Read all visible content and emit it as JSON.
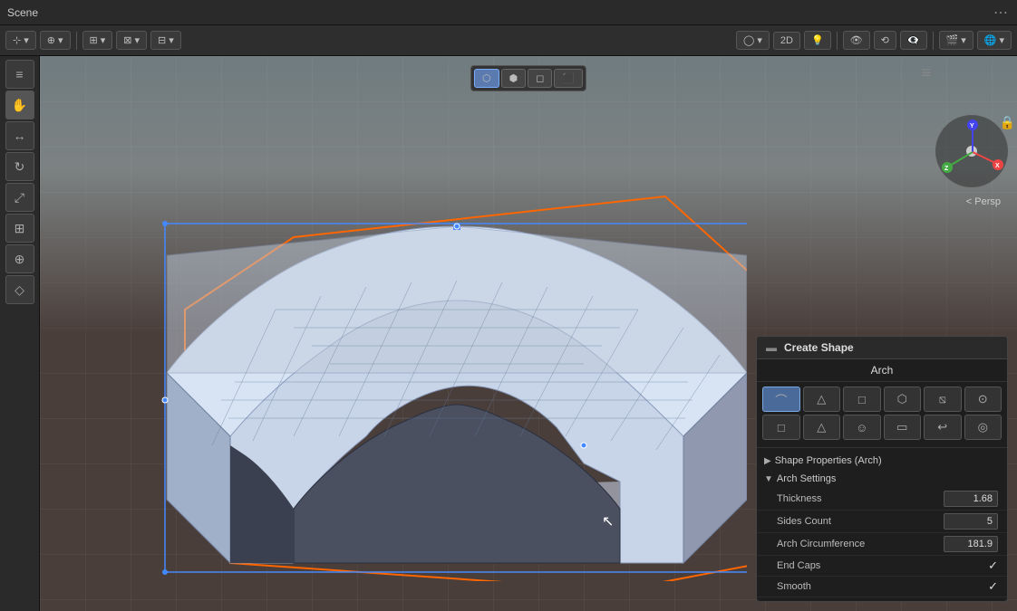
{
  "window": {
    "title": "Scene",
    "menu_dots": "⋯"
  },
  "toolbar": {
    "items": [
      {
        "label": "🔀",
        "id": "transform"
      },
      {
        "label": "↗",
        "id": "move"
      },
      {
        "label": "⊞",
        "id": "grid1"
      },
      {
        "label": "⊟",
        "id": "grid2"
      },
      {
        "label": "⊠",
        "id": "grid3"
      }
    ],
    "right_items": [
      {
        "label": "◯",
        "id": "shape"
      },
      {
        "label": "2D",
        "id": "2d"
      },
      {
        "label": "💡",
        "id": "light"
      },
      {
        "label": "👁",
        "id": "view"
      },
      {
        "label": "⟲",
        "id": "rotate"
      },
      {
        "label": "👁‍🗨",
        "id": "render"
      },
      {
        "label": "🎬",
        "id": "camera"
      },
      {
        "label": "🌐",
        "id": "world"
      }
    ]
  },
  "viewport": {
    "header_buttons": [
      {
        "label": "⬡",
        "id": "solid",
        "active": true
      },
      {
        "label": "⬢",
        "id": "wireframe",
        "active": false
      },
      {
        "label": "◻",
        "id": "material",
        "active": false
      },
      {
        "label": "⬛",
        "id": "rendered",
        "active": false
      }
    ],
    "perspective_label": "< Persp",
    "menu_icon": "≡"
  },
  "sidebar": {
    "buttons": [
      {
        "icon": "≡",
        "label": "menu",
        "active": false
      },
      {
        "icon": "✋",
        "label": "grab",
        "active": true
      },
      {
        "icon": "↔",
        "label": "move",
        "active": false
      },
      {
        "icon": "↻",
        "label": "rotate",
        "active": false
      },
      {
        "icon": "⤢",
        "label": "scale",
        "active": false
      },
      {
        "icon": "⊞",
        "label": "transform",
        "active": false
      },
      {
        "icon": "⊕",
        "label": "annotate",
        "active": false
      },
      {
        "icon": "◇",
        "label": "measure",
        "active": false
      }
    ]
  },
  "gizmo": {
    "x_label": "X",
    "y_label": "Y",
    "z_label": "Z"
  },
  "panel": {
    "header_dots": "▬",
    "title": "Create Shape",
    "subtitle": "Arch",
    "shape_types_row1": [
      {
        "icon": "⌒",
        "id": "arch",
        "active": true
      },
      {
        "icon": "△",
        "id": "triangle"
      },
      {
        "icon": "□",
        "id": "box"
      },
      {
        "icon": "⬡",
        "id": "cylinder"
      },
      {
        "icon": "⧅",
        "id": "capsule"
      },
      {
        "icon": "⊙",
        "id": "torus"
      }
    ],
    "shape_types_row2": [
      {
        "icon": "□",
        "id": "plane"
      },
      {
        "icon": "△",
        "id": "cone"
      },
      {
        "icon": "☺",
        "id": "sphere"
      },
      {
        "icon": "▭",
        "id": "quad"
      },
      {
        "icon": "↩",
        "id": "curve"
      },
      {
        "icon": "◎",
        "id": "circle"
      }
    ],
    "sections": {
      "shape_properties": {
        "label": "Shape Properties (Arch)",
        "collapsed": true
      },
      "arch_settings": {
        "label": "Arch Settings",
        "collapsed": false
      }
    },
    "properties": {
      "thickness": {
        "label": "Thickness",
        "value": "1.68"
      },
      "sides_count": {
        "label": "Sides Count",
        "value": "5"
      },
      "arch_circumference": {
        "label": "Arch Circumference",
        "value": "181.9"
      },
      "end_caps": {
        "label": "End Caps",
        "checked": true,
        "check_icon": "✓"
      },
      "smooth": {
        "label": "Smooth",
        "checked": true,
        "check_icon": "✓"
      }
    }
  }
}
